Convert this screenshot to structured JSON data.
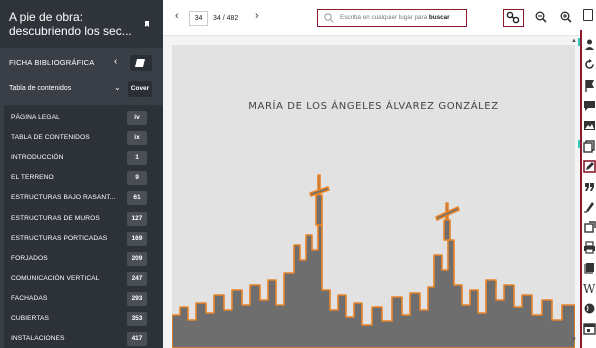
{
  "book": {
    "title": "A pie de obra: descubriendo los sec..."
  },
  "sidebar": {
    "ficha_label": "FICHA BIBLIOGRÁFICA",
    "ficha_chevron": "‹",
    "toc_label": "Tabla de contenidos",
    "toc_chevron": "⌄",
    "cover_label": "Cover",
    "toc_items": [
      {
        "label": "PÁGINA LEGAL",
        "page": "iv"
      },
      {
        "label": "TABLA DE CONTENIDOS",
        "page": "ix"
      },
      {
        "label": "INTRODUCCIÓN",
        "page": "1"
      },
      {
        "label": "EL TERRENO",
        "page": "9"
      },
      {
        "label": "ESTRUCTURAS BAJO RASANT...",
        "page": "61"
      },
      {
        "label": "ESTRUCTURAS DE MUROS",
        "page": "127"
      },
      {
        "label": "ESTRUCTURAS PORTICADAS",
        "page": "169"
      },
      {
        "label": "FORJADOS",
        "page": "209"
      },
      {
        "label": "COMUNICACIÓN VERTICAL",
        "page": "247"
      },
      {
        "label": "FACHADAS",
        "page": "293"
      },
      {
        "label": "CUBIERTAS",
        "page": "353"
      },
      {
        "label": "INSTALACIONES",
        "page": "417"
      }
    ]
  },
  "toolbar": {
    "prev_arrow": "‹",
    "next_arrow": "›",
    "page_input": "34",
    "page_total": "34 / 482",
    "search_placeholder": "Escriba en cualquier lugar para",
    "search_keyword": "buscar"
  },
  "page": {
    "author": "MARÍA DE LOS ÁNGELES ÁLVAREZ GONZÁLEZ"
  },
  "colors": {
    "accent": "#8a1a2c",
    "sidebar": "#3a3f47",
    "teal": "#38c8c0",
    "skyline": "#6e6e6e",
    "skyline_outline": "#e8842a"
  },
  "tool_icons": [
    "user-icon",
    "refresh-icon",
    "flag-icon",
    "comment-icon",
    "image-icon",
    "copy-icon",
    "edit-icon",
    "quote-icon",
    "highlight-icon",
    "share-icon",
    "print-icon",
    "book-icon",
    "wikipedia-icon",
    "globe-icon",
    "calendar-icon"
  ]
}
